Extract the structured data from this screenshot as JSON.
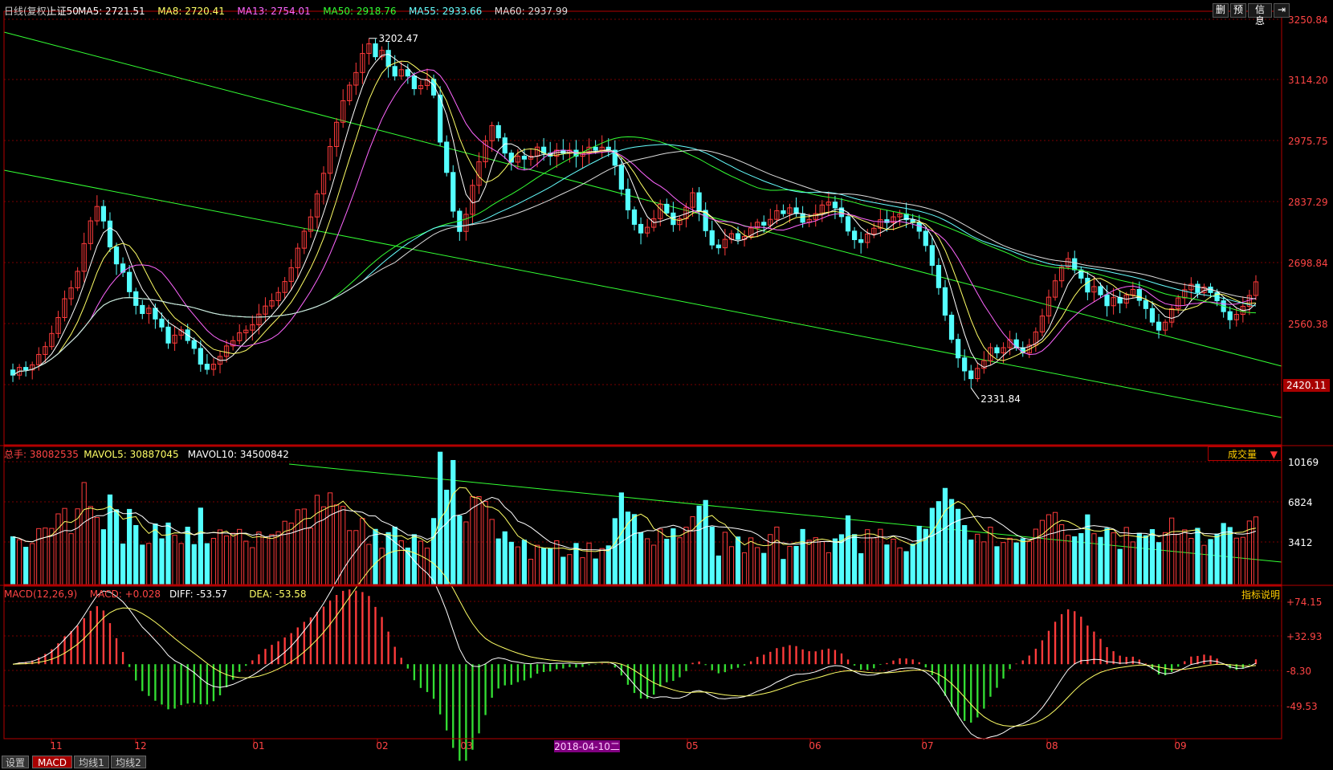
{
  "price_panel": {
    "legend": [
      {
        "text": "日线(复权)",
        "color": "#cccccc"
      },
      {
        "text": "上证50",
        "color": "#ffffff"
      },
      {
        "text": "MA5: 2721.51",
        "color": "#ffffff"
      },
      {
        "text": "MA8: 2720.41",
        "color": "#ffff66"
      },
      {
        "text": "MA13: 2754.01",
        "color": "#ff66ff"
      },
      {
        "text": "MA50: 2918.76",
        "color": "#33ff33"
      },
      {
        "text": "MA55: 2933.66",
        "color": "#66ffff"
      },
      {
        "text": "MA60: 2937.99",
        "color": "#dddddd"
      }
    ],
    "y_ticks": [
      "3250.84",
      "3114.20",
      "2975.75",
      "2837.29",
      "2698.84",
      "2560.38"
    ],
    "last_price": "2420.11",
    "high_label": "3202.47",
    "low_label": "2331.84",
    "buttons": [
      {
        "label": "删"
      },
      {
        "label": "预"
      },
      {
        "label": "信息"
      },
      {
        "label": "⇥"
      }
    ]
  },
  "volume_panel": {
    "legend": [
      {
        "text": "总手: 38082535",
        "color": "#ff4444"
      },
      {
        "text": "MAVOL5: 30887045",
        "color": "#ffff66"
      },
      {
        "text": "MAVOL10: 34500842",
        "color": "#ffffff"
      }
    ],
    "y_ticks": [
      "10169",
      "6824",
      "3412"
    ],
    "dropdown_label": "成交量"
  },
  "macd_panel": {
    "legend": [
      {
        "text": "MACD(12,26,9)",
        "color": "#ff4444"
      },
      {
        "text": "MACD: +0.028",
        "color": "#ff4444"
      },
      {
        "text": "DIFF: -53.57",
        "color": "#ffffff"
      },
      {
        "text": "DEA: -53.58",
        "color": "#ffff66"
      }
    ],
    "y_ticks": [
      "+74.15",
      "+32.93",
      "-8.30",
      "-49.53"
    ],
    "help_label": "指标说明"
  },
  "x_axis": {
    "labels": [
      "11",
      "12",
      "01",
      "02",
      "03",
      "05",
      "06",
      "07",
      "08",
      "09"
    ],
    "cursor_label": "2018-04-10二"
  },
  "tabs": [
    {
      "label": "设置",
      "active": false
    },
    {
      "label": "MACD",
      "active": true
    },
    {
      "label": "均线1",
      "active": false
    },
    {
      "label": "均线2",
      "active": false
    }
  ],
  "colors": {
    "up": "#ff3b3b",
    "down": "#54ffff",
    "grid": "#7a0000",
    "axis": "#b30000",
    "trend": "#33ff33"
  },
  "chart_data": {
    "type": "candlestick",
    "series": "上证50",
    "start": 2880,
    "returns": [
      -0.004,
      0.006,
      -0.002,
      0.004,
      0.008,
      0.006,
      0.01,
      0.012,
      0.014,
      0.008,
      0.012,
      0.02,
      0.016,
      0.01,
      -0.01,
      -0.018,
      -0.012,
      -0.006,
      -0.014,
      -0.01,
      -0.006,
      0.004,
      -0.008,
      -0.006,
      -0.012,
      0.006,
      0.004,
      -0.008,
      -0.006,
      -0.012,
      -0.004,
      0.004,
      0.006,
      0.008,
      0.004,
      0.006,
      0.002,
      0.004,
      0.008,
      0.006,
      0.004,
      0.006,
      0.008,
      0.01,
      0.014,
      0.012,
      0.01,
      0.016,
      0.014,
      0.018,
      0.016,
      0.014,
      0.01,
      0.008,
      0.012,
      0.006,
      -0.008,
      0.004,
      -0.01,
      -0.006,
      0.004,
      -0.004,
      -0.008,
      0.002,
      0.004,
      -0.01,
      -0.03,
      -0.02,
      -0.026,
      -0.014,
      0.012,
      0.02,
      0.016,
      0.014,
      0.01,
      -0.008,
      -0.01,
      -0.006,
      0.004,
      -0.002,
      0.002,
      0.006,
      -0.004,
      -0.002,
      0.004,
      -0.002,
      0.002,
      -0.004,
      0.002,
      0.004,
      -0.002,
      0.002,
      -0.002,
      -0.01,
      -0.016,
      -0.014,
      -0.01,
      -0.006,
      0.004,
      0.006,
      0.01,
      -0.006,
      -0.008,
      0.004,
      0.008,
      0.01,
      -0.012,
      -0.014,
      -0.01,
      -0.002,
      0.006,
      0.004,
      -0.004,
      0.002,
      0.006,
      0.004,
      -0.002,
      0.004,
      0.006,
      -0.002,
      0.004,
      -0.004,
      -0.006,
      0.002,
      0.004,
      0.006,
      0.002,
      -0.004,
      -0.006,
      -0.01,
      -0.006,
      -0.002,
      0.006,
      0.004,
      0.006,
      -0.002,
      0.004,
      0.002,
      -0.004,
      -0.002,
      -0.006,
      -0.01,
      -0.014,
      -0.016,
      -0.02,
      -0.018,
      -0.014,
      -0.01,
      -0.006,
      0.008,
      0.006,
      0.01,
      -0.004,
      0.004,
      0.006,
      -0.006,
      -0.004,
      0.006,
      0.01,
      0.012,
      0.014,
      0.012,
      0.01,
      0.006,
      -0.008,
      -0.006,
      -0.01,
      0.004,
      -0.006,
      -0.008,
      0.006,
      -0.004,
      0.006,
      0.004,
      -0.008,
      -0.006,
      -0.01,
      -0.006,
      0.006,
      0.01,
      0.008,
      0.006,
      0.004,
      -0.006,
      0.004,
      -0.004,
      -0.006,
      -0.008,
      -0.006,
      0.004,
      0.006,
      0.008,
      0.01
    ],
    "x_labels": [
      "11",
      "12",
      "01",
      "02",
      "03",
      "05",
      "06",
      "07",
      "08",
      "09"
    ],
    "y_ticks": [
      3250.84,
      3114.2,
      2975.75,
      2837.29,
      2698.84,
      2560.38
    ],
    "volume_ticks": [
      10169,
      6824,
      3412
    ],
    "macd_ticks": [
      74.15,
      32.93,
      -8.3,
      -49.53
    ]
  }
}
